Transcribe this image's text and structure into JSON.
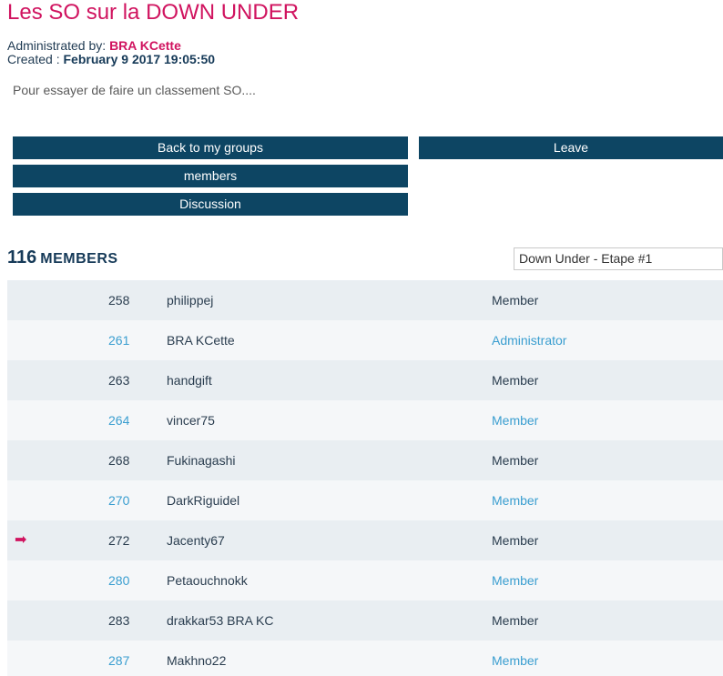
{
  "group": {
    "title": "Les SO sur la DOWN UNDER",
    "administrated_label": "Administrated by:",
    "administrator": "BRA KCette",
    "created_label": "Created :",
    "created_date": "February 9 2017 19:05:50",
    "description": "Pour essayer de faire un classement SO...."
  },
  "buttons": {
    "back": "Back to my groups",
    "leave": "Leave",
    "members": "members",
    "discussion": "Discussion"
  },
  "members_section": {
    "count": "116",
    "label": "MEMBERS",
    "stage_selected": "Down Under - Etape #1"
  },
  "colors": {
    "accent": "#d0135f",
    "button_bg": "#0d4563",
    "link_blue": "#3a9ed0"
  },
  "members": [
    {
      "rank": "258",
      "name": "philippej",
      "role": "Member",
      "current": false
    },
    {
      "rank": "261",
      "name": "BRA KCette",
      "role": "Administrator",
      "current": false
    },
    {
      "rank": "263",
      "name": "handgift",
      "role": "Member",
      "current": false
    },
    {
      "rank": "264",
      "name": "vincer75",
      "role": "Member",
      "current": false
    },
    {
      "rank": "268",
      "name": "Fukinagashi",
      "role": "Member",
      "current": false
    },
    {
      "rank": "270",
      "name": "DarkRiguidel",
      "role": "Member",
      "current": false
    },
    {
      "rank": "272",
      "name": "Jacenty67",
      "role": "Member",
      "current": true,
      "marker_icon": "arrow-right-icon"
    },
    {
      "rank": "280",
      "name": "Petaouchnokk",
      "role": "Member",
      "current": false
    },
    {
      "rank": "283",
      "name": "drakkar53 BRA KC",
      "role": "Member",
      "current": false
    },
    {
      "rank": "287",
      "name": "Makhno22",
      "role": "Member",
      "current": false
    }
  ]
}
